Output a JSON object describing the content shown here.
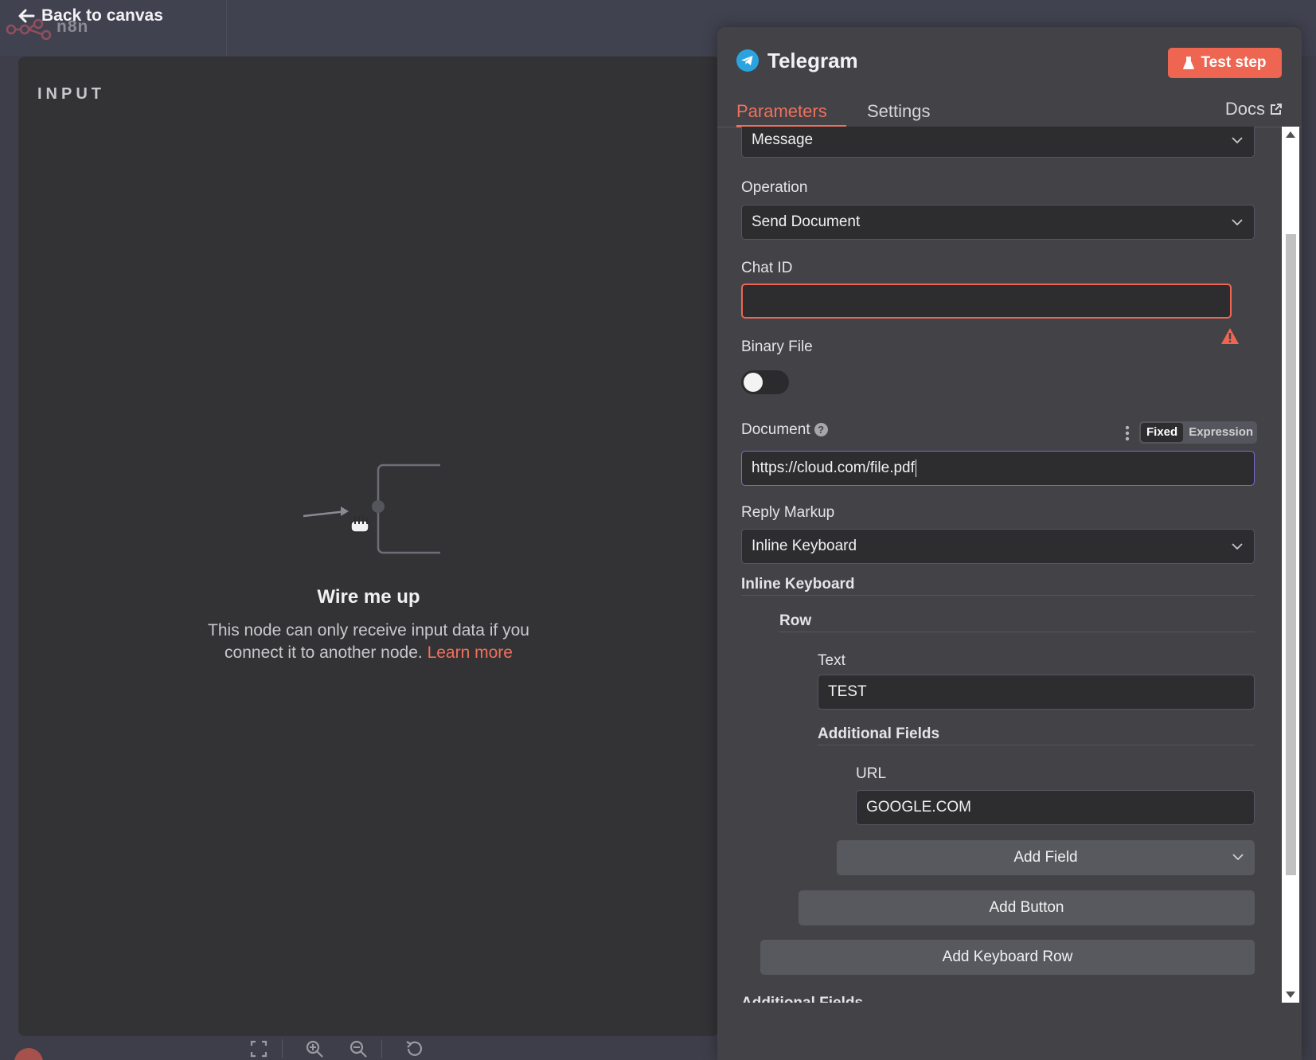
{
  "canvas": {
    "back_label": "Back to canvas",
    "logo_text": "n8n"
  },
  "input_panel": {
    "title": "INPUT",
    "empty_title": "Wire me up",
    "empty_desc": "This node can only receive input data if you connect it to another node.",
    "learn_more": "Learn more"
  },
  "node": {
    "title": "Telegram",
    "icon": "telegram-icon",
    "test_button": "Test step",
    "tabs": [
      "Parameters",
      "Settings"
    ],
    "docs": "Docs"
  },
  "params": {
    "resource_value": "Message",
    "operation_label": "Operation",
    "operation_value": "Send Document",
    "chat_id_label": "Chat ID",
    "chat_id_value": "",
    "binary_file_label": "Binary File",
    "binary_file_on": false,
    "document_label": "Document",
    "document_mode": [
      "Fixed",
      "Expression"
    ],
    "document_value": "https://cloud.com/file.pdf",
    "reply_markup_label": "Reply Markup",
    "reply_markup_value": "Inline Keyboard",
    "inline_keyboard_label": "Inline Keyboard",
    "row_label": "Row",
    "text_label": "Text",
    "text_value": "TEST",
    "additional_fields_label": "Additional Fields",
    "url_label": "URL",
    "url_value": "GOOGLE.COM",
    "add_field": "Add Field",
    "add_button": "Add Button",
    "add_keyboard_row": "Add Keyboard Row",
    "additional_fields_bottom": "Additional Fields"
  },
  "colors": {
    "accent": "#ee6651",
    "error": "#ee6651",
    "focus": "#7c6cd0",
    "telegram": "#2aa3df"
  }
}
